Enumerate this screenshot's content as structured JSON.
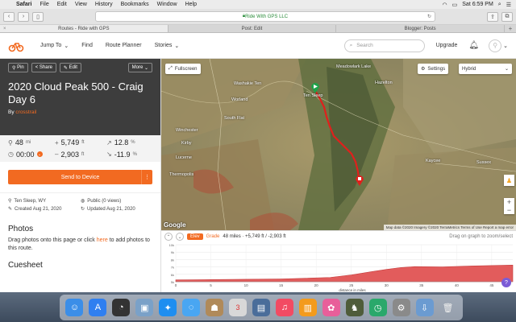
{
  "menubar": {
    "app": "Safari",
    "items": [
      "File",
      "Edit",
      "View",
      "History",
      "Bookmarks",
      "Window",
      "Help"
    ],
    "clock": "Sat 6:59 PM"
  },
  "browser": {
    "url": "Ride With GPS LLC",
    "tabs": [
      {
        "label": "Routes - Ride with GPS",
        "active": true
      },
      {
        "label": "Post: Edit",
        "active": false
      },
      {
        "label": "Blogger: Posts",
        "active": false
      }
    ]
  },
  "header": {
    "nav": [
      "Jump To",
      "Find",
      "Route Planner",
      "Stories"
    ],
    "search_placeholder": "Search",
    "upgrade": "Upgrade"
  },
  "route": {
    "buttons": {
      "pin": "Pin",
      "share": "Share",
      "edit": "Edit",
      "more": "More"
    },
    "title": "2020 Cloud Peak 500 - Craig Day 6",
    "by": "By",
    "author": "crosstrail",
    "stats": {
      "distance": "48",
      "distance_unit": "mi",
      "elev_gain": "5,749",
      "elev_gain_unit": "ft",
      "max_grade": "12.8",
      "max_grade_unit": "%",
      "time": "00:00",
      "elev_loss": "2,903",
      "elev_loss_unit": "ft",
      "min_grade": "-11.9",
      "min_grade_unit": "%"
    },
    "send_button": "Send to Device",
    "meta": {
      "location": "Ten Sleep, WY",
      "visibility": "Public (0 views)",
      "created": "Created Aug 21, 2020",
      "updated": "Updated Aug 21, 2020"
    },
    "photos_heading": "Photos",
    "photos_text_before": "Drag photos onto this page or click ",
    "photos_link": "here",
    "photos_text_after": " to add photos to this route.",
    "cuesheet_heading": "Cuesheet"
  },
  "map": {
    "fullscreen": "Fullscreen",
    "settings": "Settings",
    "map_type": "Hybrid",
    "places": [
      "Meadowlark Lake",
      "Ten Sleep",
      "Hazelton",
      "Washakie Ten",
      "Worland",
      "South Flat",
      "Winchester",
      "Kirby",
      "Lucerne",
      "Thermopolis",
      "Kaycee",
      "Sussex"
    ],
    "attribution": "Map data ©2020 Imagery ©2020 TerraMetrics   Terms of Use   Report a map error",
    "google": "Google"
  },
  "elevation": {
    "tag": "Elev",
    "grade": "Grade",
    "info": "48 miles · +5,749 ft / -2,903 ft",
    "hint": "Drag on graph to zoom/select",
    "xlabel": "distance in miles",
    "yticks": [
      "10k",
      "9k",
      "8k",
      "7k",
      "6k",
      "5k"
    ],
    "xticks": [
      "0",
      "5",
      "10",
      "15",
      "20",
      "25",
      "30",
      "35",
      "40",
      "45"
    ],
    "profile_miles": [
      0,
      5,
      10,
      15,
      18,
      22,
      25,
      28,
      30,
      32,
      34,
      38,
      42,
      46,
      48
    ],
    "profile_ft": [
      4300,
      4350,
      4400,
      4450,
      4550,
      4700,
      5100,
      5650,
      6000,
      6300,
      6450,
      6400,
      6550,
      6650,
      6700
    ],
    "ylim": [
      4000,
      10000
    ],
    "xlim": [
      0,
      48
    ]
  },
  "colors": {
    "accent": "#f26a21",
    "route": "#e0201c",
    "dark_panel": "#3d3d3d"
  }
}
